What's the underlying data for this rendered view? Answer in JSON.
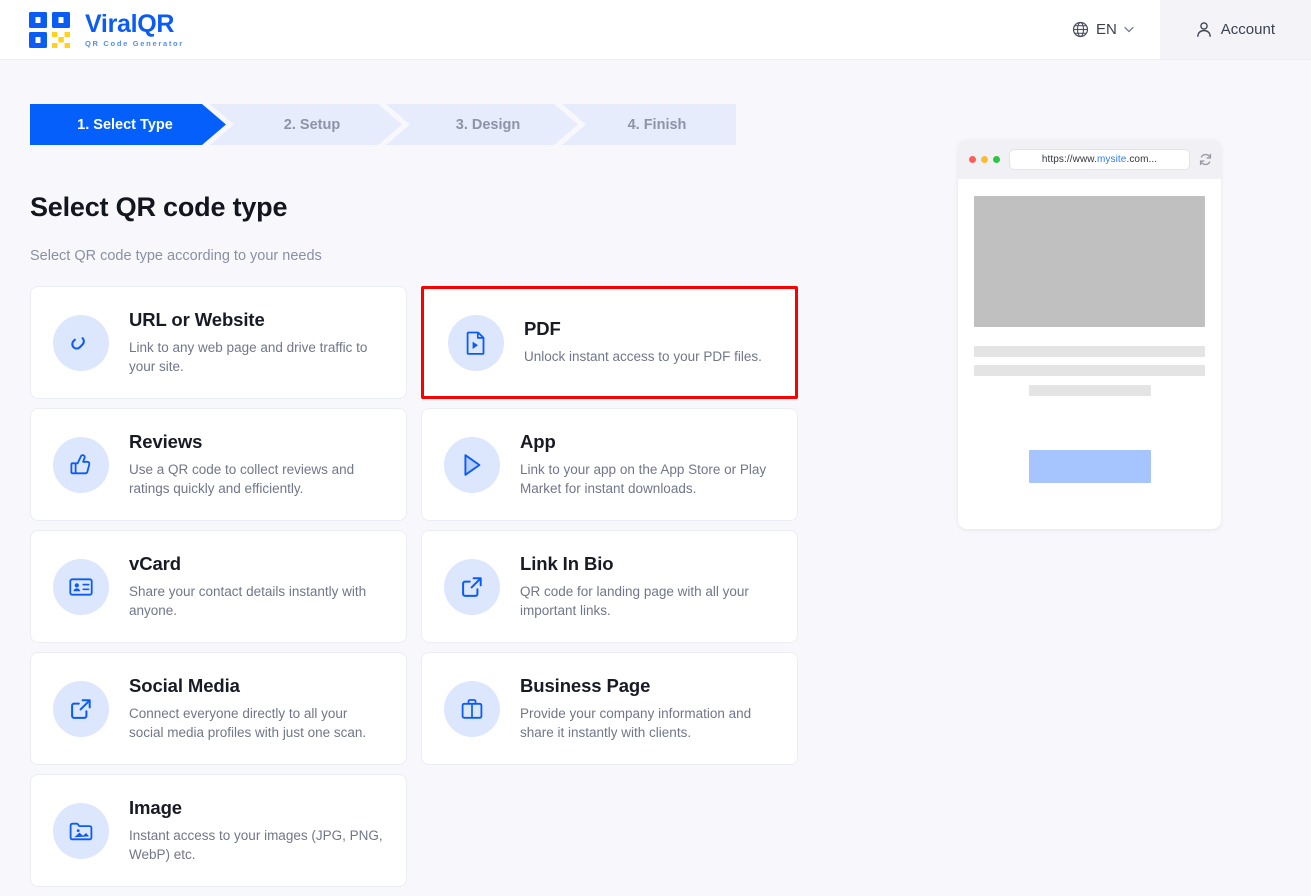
{
  "header": {
    "brand_name": "ViralQR",
    "brand_tagline": "QR Code Generator",
    "language": "EN",
    "account_label": "Account"
  },
  "steps": [
    {
      "label": "1. Select Type",
      "active": true
    },
    {
      "label": "2. Setup",
      "active": false
    },
    {
      "label": "3. Design",
      "active": false
    },
    {
      "label": "4. Finish",
      "active": false
    }
  ],
  "main": {
    "title": "Select QR code type",
    "subtitle": "Select QR code type according to your needs"
  },
  "cards": [
    {
      "title": "URL or Website",
      "desc": "Link to any web page and drive traffic to your site.",
      "icon": "link-icon",
      "highlighted": false
    },
    {
      "title": "PDF",
      "desc": "Unlock instant access to your PDF files.",
      "icon": "pdf-file-icon",
      "highlighted": true
    },
    {
      "title": "Reviews",
      "desc": "Use a QR code to collect reviews and ratings quickly and efficiently.",
      "icon": "thumbs-up-icon",
      "highlighted": false
    },
    {
      "title": "App",
      "desc": "Link to your app on the App Store or Play Market for instant downloads.",
      "icon": "play-store-icon",
      "highlighted": false
    },
    {
      "title": "vCard",
      "desc": "Share your contact details instantly with anyone.",
      "icon": "contact-card-icon",
      "highlighted": false
    },
    {
      "title": "Link In Bio",
      "desc": "QR code for landing page with all your important links.",
      "icon": "external-link-icon",
      "highlighted": false
    },
    {
      "title": "Social Media",
      "desc": "Connect everyone directly to all your social media profiles with just one scan.",
      "icon": "external-link-icon",
      "highlighted": false
    },
    {
      "title": "Business Page",
      "desc": "Provide your company information and share it instantly with clients.",
      "icon": "briefcase-icon",
      "highlighted": false
    },
    {
      "title": "Image",
      "desc": "Instant access to your images (JPG, PNG, WebP) etc.",
      "icon": "photo-icon",
      "highlighted": false
    }
  ],
  "preview": {
    "url_prefix": "https://www.",
    "url_highlight": "mysite",
    "url_suffix": ".com..."
  },
  "colors": {
    "accent": "#0560fb",
    "step_inactive_bg": "#e6ecfb",
    "step_inactive_text": "#8e93a6",
    "icon_bg": "#dce6fd",
    "highlight_border": "#fa0000",
    "page_bg": "#f8f8fc",
    "brand_yellow": "#ffd21f"
  }
}
